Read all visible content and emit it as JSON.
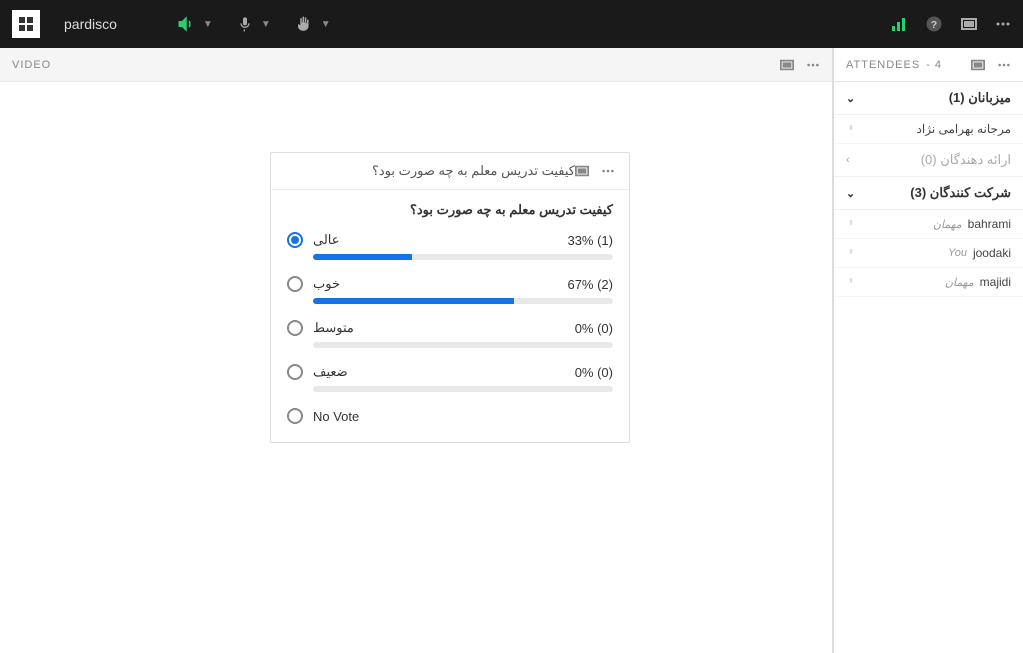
{
  "topbar": {
    "room_name": "pardisco"
  },
  "video_panel": {
    "title": "VIDEO"
  },
  "poll": {
    "title": "کیفیت تدریس معلم به چه صورت بود؟",
    "question": "کیفیت تدریس معلم به چه صورت بود؟",
    "options": [
      {
        "label": "عالی",
        "stats": "33% (1)",
        "percent": 33,
        "selected": true,
        "has_bar": true
      },
      {
        "label": "خوب",
        "stats": "67% (2)",
        "percent": 67,
        "selected": false,
        "has_bar": true
      },
      {
        "label": "متوسط",
        "stats": "0% (0)",
        "percent": 0,
        "selected": false,
        "has_bar": true
      },
      {
        "label": "ضعیف",
        "stats": "0% (0)",
        "percent": 0,
        "selected": false,
        "has_bar": true
      },
      {
        "label": "No Vote",
        "stats": "",
        "percent": 0,
        "selected": false,
        "has_bar": false
      }
    ]
  },
  "attendees": {
    "panel_title": "ATTENDEES",
    "count_suffix": "- 4",
    "sections": [
      {
        "title": "میزبانان (1)",
        "expanded": true,
        "disabled": false,
        "items": [
          {
            "name": "مرجانه بهرامی نژاد",
            "role": "",
            "rtl": true
          }
        ]
      },
      {
        "title": "ارائه دهندگان (0)",
        "expanded": false,
        "disabled": true,
        "items": []
      },
      {
        "title": "شرکت کنندگان (3)",
        "expanded": true,
        "disabled": false,
        "items": [
          {
            "name": "bahrami",
            "role": "مهمان",
            "rtl": false
          },
          {
            "name": "joodaki",
            "role": "You",
            "rtl": false
          },
          {
            "name": "majidi",
            "role": "مهمان",
            "rtl": false
          }
        ]
      }
    ]
  }
}
